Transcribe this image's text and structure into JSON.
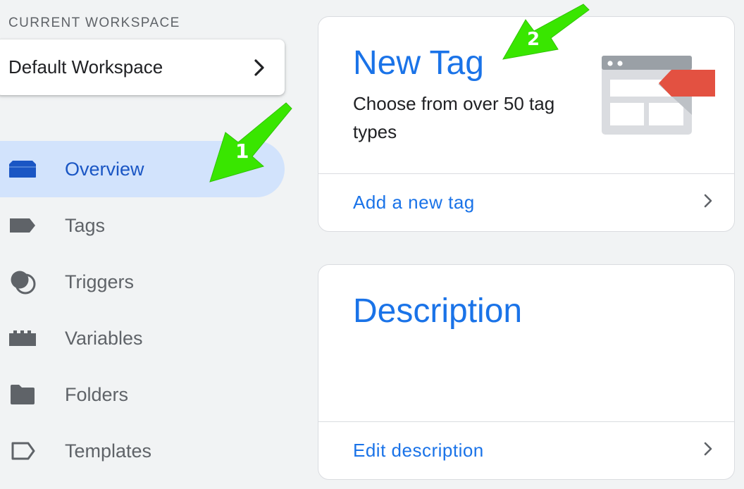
{
  "workspace": {
    "heading": "CURRENT WORKSPACE",
    "name": "Default Workspace"
  },
  "nav": {
    "items": [
      {
        "label": "Overview",
        "icon": "overview-icon",
        "active": true
      },
      {
        "label": "Tags",
        "icon": "tag-icon"
      },
      {
        "label": "Triggers",
        "icon": "triggers-icon"
      },
      {
        "label": "Variables",
        "icon": "variables-icon"
      },
      {
        "label": "Folders",
        "icon": "folder-icon"
      },
      {
        "label": "Templates",
        "icon": "template-icon"
      }
    ]
  },
  "new_tag_card": {
    "title": "New Tag",
    "subtitle": "Choose from over 50 tag types",
    "action": "Add a new tag"
  },
  "description_card": {
    "title": "Description",
    "action": "Edit description"
  },
  "annotations": {
    "arrow_1": "1",
    "arrow_2": "2"
  },
  "colors": {
    "accent": "#1a73e8",
    "active_nav_bg": "#d2e3fc",
    "active_nav_text": "#1a56c4",
    "annotation": "#39e600",
    "tag_red": "#e35141"
  }
}
